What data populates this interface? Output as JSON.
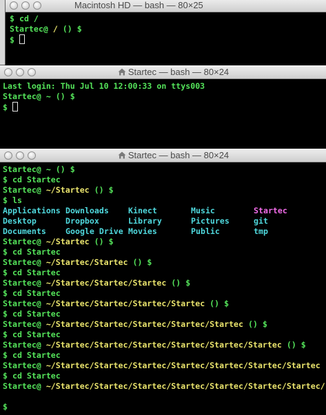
{
  "windows": [
    {
      "title": "Macintosh HD — bash — 80×25",
      "lines": [
        {
          "s": [
            {
              "t": "$ cd /",
              "c": "g"
            }
          ]
        },
        {
          "s": [
            {
              "t": "Startec@ ",
              "c": "g"
            },
            {
              "t": "/ ",
              "c": "y"
            },
            {
              "t": "() $",
              "c": "g"
            }
          ]
        },
        {
          "s": [
            {
              "t": "$ ",
              "c": "g"
            }
          ],
          "cursor": true
        }
      ]
    },
    {
      "title": "Startec — bash — 80×24",
      "icon": "house-icon",
      "lines": [
        {
          "s": [
            {
              "t": "Last login: Thu Jul 10 12:00:33 on ttys003",
              "c": "g"
            }
          ]
        },
        {
          "s": [
            {
              "t": "Startec@ ~ () $",
              "c": "g"
            }
          ]
        },
        {
          "s": [
            {
              "t": "$ ",
              "c": "g"
            }
          ],
          "cursor": true
        }
      ]
    },
    {
      "title": "Startec — bash — 80×24",
      "icon": "house-icon",
      "lines": [
        {
          "s": [
            {
              "t": "Startec@ ~ () $",
              "c": "g"
            }
          ]
        },
        {
          "s": [
            {
              "t": "$ cd Startec",
              "c": "g"
            }
          ]
        },
        {
          "s": [
            {
              "t": "Startec@ ",
              "c": "g"
            },
            {
              "t": "~/Startec ",
              "c": "y"
            },
            {
              "t": "() $",
              "c": "g"
            }
          ]
        },
        {
          "s": [
            {
              "t": "$ ls",
              "c": "g"
            }
          ]
        },
        {
          "ls": [
            {
              "t": "Applications",
              "c": "c"
            },
            {
              "t": "Downloads",
              "c": "c"
            },
            {
              "t": "Kinect",
              "c": "c"
            },
            {
              "t": "Music",
              "c": "c"
            },
            {
              "t": "Startec",
              "c": "m"
            }
          ]
        },
        {
          "ls": [
            {
              "t": "Desktop",
              "c": "c"
            },
            {
              "t": "Dropbox",
              "c": "c"
            },
            {
              "t": "Library",
              "c": "c"
            },
            {
              "t": "Pictures",
              "c": "c"
            },
            {
              "t": "git",
              "c": "c"
            }
          ]
        },
        {
          "ls": [
            {
              "t": "Documents",
              "c": "c"
            },
            {
              "t": "Google Drive",
              "c": "c"
            },
            {
              "t": "Movies",
              "c": "c"
            },
            {
              "t": "Public",
              "c": "c"
            },
            {
              "t": "tmp",
              "c": "c"
            }
          ]
        },
        {
          "s": [
            {
              "t": "Startec@ ",
              "c": "g"
            },
            {
              "t": "~/Startec ",
              "c": "y"
            },
            {
              "t": "() $",
              "c": "g"
            }
          ]
        },
        {
          "s": [
            {
              "t": "$ cd Startec",
              "c": "g"
            }
          ]
        },
        {
          "s": [
            {
              "t": "Startec@ ",
              "c": "g"
            },
            {
              "t": "~/Startec/Startec ",
              "c": "y"
            },
            {
              "t": "() $",
              "c": "g"
            }
          ]
        },
        {
          "s": [
            {
              "t": "$ cd Startec",
              "c": "g"
            }
          ]
        },
        {
          "s": [
            {
              "t": "Startec@ ",
              "c": "g"
            },
            {
              "t": "~/Startec/Startec/Startec ",
              "c": "y"
            },
            {
              "t": "() $",
              "c": "g"
            }
          ]
        },
        {
          "s": [
            {
              "t": "$ cd Startec",
              "c": "g"
            }
          ]
        },
        {
          "s": [
            {
              "t": "Startec@ ",
              "c": "g"
            },
            {
              "t": "~/Startec/Startec/Startec/Startec ",
              "c": "y"
            },
            {
              "t": "() $",
              "c": "g"
            }
          ]
        },
        {
          "s": [
            {
              "t": "$ cd Startec",
              "c": "g"
            }
          ]
        },
        {
          "s": [
            {
              "t": "Startec@ ",
              "c": "g"
            },
            {
              "t": "~/Startec/Startec/Startec/Startec/Startec ",
              "c": "y"
            },
            {
              "t": "() $",
              "c": "g"
            }
          ]
        },
        {
          "s": [
            {
              "t": "$ cd Startec",
              "c": "g"
            }
          ]
        },
        {
          "s": [
            {
              "t": "Startec@ ",
              "c": "g"
            },
            {
              "t": "~/Startec/Startec/Startec/Startec/Startec/Startec ",
              "c": "y"
            },
            {
              "t": "() $",
              "c": "g"
            }
          ]
        },
        {
          "s": [
            {
              "t": "$ cd Startec",
              "c": "g"
            }
          ]
        },
        {
          "s": [
            {
              "t": "Startec@ ",
              "c": "g"
            },
            {
              "t": "~/Startec/Startec/Startec/Startec/Startec/Startec/Startec",
              "c": "y"
            }
          ]
        },
        {
          "s": [
            {
              "t": "$ cd Startec",
              "c": "g"
            }
          ]
        },
        {
          "s": [
            {
              "t": "Startec@ ",
              "c": "g"
            },
            {
              "t": "~/Startec/Startec/Startec/Startec/Startec/Startec/Startec/",
              "c": "y"
            }
          ]
        },
        {
          "s": [
            {
              "t": "",
              "c": "g"
            }
          ]
        },
        {
          "s": [
            {
              "t": "$",
              "c": "g"
            }
          ]
        }
      ]
    }
  ],
  "colors": {
    "prompt_green": "#54e35a",
    "path_yellow": "#e9e36c",
    "dir_cyan": "#4fd8dd",
    "highlight_magenta": "#f16ce8"
  }
}
